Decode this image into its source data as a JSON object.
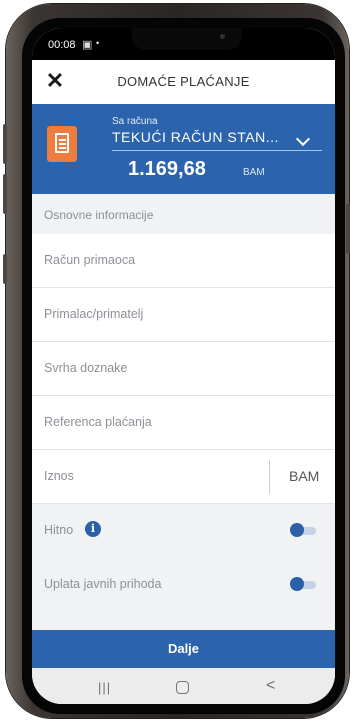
{
  "status_bar": {
    "time": "00:08"
  },
  "header": {
    "title": "DOMAĆE PLAĆANJE"
  },
  "account": {
    "from_label": "Sa računa",
    "name": "TEKUĆI RAČUN STAN...",
    "balance": "1.169,68",
    "currency": "BAM"
  },
  "section": {
    "title": "Osnovne informacije"
  },
  "fields": {
    "recipient_account": "Račun primaoca",
    "recipient": "Primalac/primatelj",
    "purpose": "Svrha doznake",
    "reference": "Referenca plaćanja",
    "amount": "Iznos",
    "amount_currency": "BAM"
  },
  "toggles": {
    "urgent_label": "Hitno",
    "urgent_on": false,
    "public_revenue_label": "Uplata javnih prihoda",
    "public_revenue_on": false
  },
  "footer": {
    "next_label": "Dalje"
  },
  "colors": {
    "primary": "#2c63ad",
    "accent_icon": "#ee7c3c",
    "background": "#f1f2f4"
  },
  "icons": {
    "close": "close-icon",
    "account": "document-icon",
    "dropdown": "chevron-down-icon",
    "info": "info-icon"
  }
}
